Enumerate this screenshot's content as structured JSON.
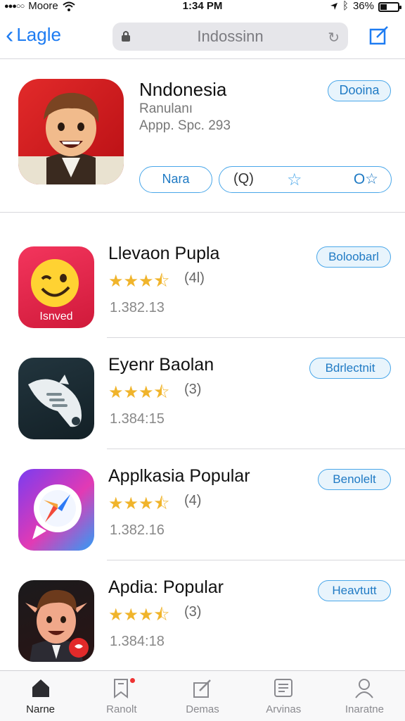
{
  "status_bar": {
    "carrier": "Moore",
    "time": "1:34 PM",
    "battery": "36%",
    "battery_level": 0.36
  },
  "nav": {
    "back_label": "Lagle",
    "search_text": "Indossinn",
    "reload_text": "C"
  },
  "featured": {
    "title": "Nndonesia",
    "subtitle": "Ranulanı",
    "meta": "Appp. Spc. 293",
    "get_button": "Dooina",
    "name_button": "Nara",
    "rating_q": "(Q)",
    "rating_o": "O"
  },
  "apps": [
    {
      "title": "Llevaon Pupla",
      "rating_count": "(4l)",
      "meta": "1.382.13",
      "button": "Boloobarl",
      "stars": 3.5,
      "icon_label": "Isnved"
    },
    {
      "title": "Eyenr Baolan",
      "rating_count": "(3)",
      "meta": "1.384:15",
      "button": "Bdrlectnit",
      "stars": 3.5
    },
    {
      "title": "Applkasia Popular",
      "rating_count": "(4)",
      "meta": "1.382.16",
      "button": "Benolelt",
      "stars": 3.5
    },
    {
      "title": "Apdia: Popular",
      "rating_count": "(3)",
      "meta": "1.384:18",
      "button": "Heavtutt",
      "stars": 3.5
    }
  ],
  "tabs": [
    {
      "label": "Narne",
      "icon": "home-icon",
      "active": true
    },
    {
      "label": "Ranolt",
      "icon": "bookmark-icon",
      "active": false
    },
    {
      "label": "Demas",
      "icon": "edit-icon",
      "active": false
    },
    {
      "label": "Arvinas",
      "icon": "list-icon",
      "active": false
    },
    {
      "label": "Inaratne",
      "icon": "profile-icon",
      "active": false
    }
  ],
  "colors": {
    "accent": "#1e7cf2",
    "button_border": "#4aa7e9",
    "star": "#f0b42b"
  }
}
